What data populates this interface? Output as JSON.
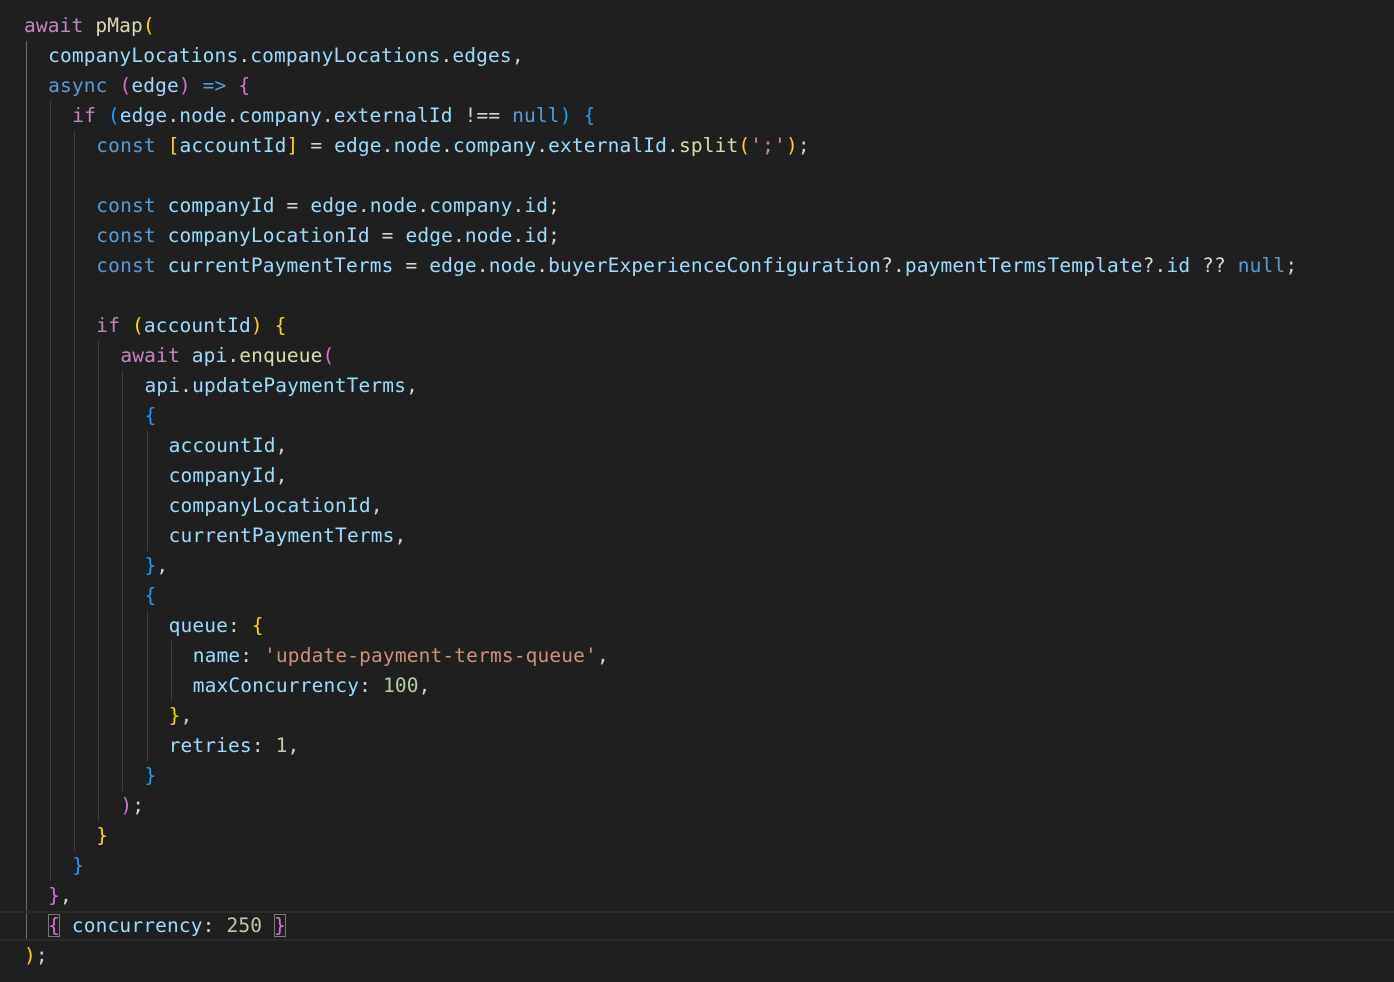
{
  "colors": {
    "background": "#1f1f1f",
    "keyword_control": "#c586c0",
    "keyword_storage": "#569cd6",
    "variable": "#9cdcfe",
    "function": "#dcdcaa",
    "string": "#ce9178",
    "number": "#b5cea8",
    "plain": "#d4d4d4",
    "bracket_1": "#ffd700",
    "bracket_2": "#da70d6",
    "bracket_3": "#179fff"
  },
  "code_lines": [
    {
      "indent": 0,
      "tokens": [
        {
          "t": "await",
          "c": "keyword_control"
        },
        {
          "t": " "
        },
        {
          "t": "pMap",
          "c": "function"
        },
        {
          "t": "(",
          "c": "bracket_1"
        }
      ]
    },
    {
      "indent": 1,
      "tokens": [
        {
          "t": "companyLocations",
          "c": "variable"
        },
        {
          "t": "."
        },
        {
          "t": "companyLocations",
          "c": "variable"
        },
        {
          "t": "."
        },
        {
          "t": "edges",
          "c": "variable"
        },
        {
          "t": ","
        }
      ]
    },
    {
      "indent": 1,
      "tokens": [
        {
          "t": "async",
          "c": "keyword_storage"
        },
        {
          "t": " "
        },
        {
          "t": "(",
          "c": "bracket_2"
        },
        {
          "t": "edge",
          "c": "variable"
        },
        {
          "t": ")",
          "c": "bracket_2"
        },
        {
          "t": " "
        },
        {
          "t": "=>",
          "c": "keyword_storage"
        },
        {
          "t": " "
        },
        {
          "t": "{",
          "c": "bracket_2"
        }
      ]
    },
    {
      "indent": 2,
      "tokens": [
        {
          "t": "if",
          "c": "keyword_control"
        },
        {
          "t": " "
        },
        {
          "t": "(",
          "c": "bracket_3"
        },
        {
          "t": "edge",
          "c": "variable"
        },
        {
          "t": "."
        },
        {
          "t": "node",
          "c": "variable"
        },
        {
          "t": "."
        },
        {
          "t": "company",
          "c": "variable"
        },
        {
          "t": "."
        },
        {
          "t": "externalId",
          "c": "variable"
        },
        {
          "t": " !== "
        },
        {
          "t": "null",
          "c": "keyword_storage"
        },
        {
          "t": ")",
          "c": "bracket_3"
        },
        {
          "t": " "
        },
        {
          "t": "{",
          "c": "bracket_3"
        }
      ]
    },
    {
      "indent": 3,
      "tokens": [
        {
          "t": "const",
          "c": "keyword_storage"
        },
        {
          "t": " "
        },
        {
          "t": "[",
          "c": "bracket_1"
        },
        {
          "t": "accountId",
          "c": "variable"
        },
        {
          "t": "]",
          "c": "bracket_1"
        },
        {
          "t": " = "
        },
        {
          "t": "edge",
          "c": "variable"
        },
        {
          "t": "."
        },
        {
          "t": "node",
          "c": "variable"
        },
        {
          "t": "."
        },
        {
          "t": "company",
          "c": "variable"
        },
        {
          "t": "."
        },
        {
          "t": "externalId",
          "c": "variable"
        },
        {
          "t": "."
        },
        {
          "t": "split",
          "c": "function"
        },
        {
          "t": "(",
          "c": "bracket_1"
        },
        {
          "t": "';'",
          "c": "string"
        },
        {
          "t": ")",
          "c": "bracket_1"
        },
        {
          "t": ";"
        }
      ]
    },
    {
      "indent": 3,
      "tokens": []
    },
    {
      "indent": 3,
      "tokens": [
        {
          "t": "const",
          "c": "keyword_storage"
        },
        {
          "t": " "
        },
        {
          "t": "companyId",
          "c": "variable"
        },
        {
          "t": " = "
        },
        {
          "t": "edge",
          "c": "variable"
        },
        {
          "t": "."
        },
        {
          "t": "node",
          "c": "variable"
        },
        {
          "t": "."
        },
        {
          "t": "company",
          "c": "variable"
        },
        {
          "t": "."
        },
        {
          "t": "id",
          "c": "variable"
        },
        {
          "t": ";"
        }
      ]
    },
    {
      "indent": 3,
      "tokens": [
        {
          "t": "const",
          "c": "keyword_storage"
        },
        {
          "t": " "
        },
        {
          "t": "companyLocationId",
          "c": "variable"
        },
        {
          "t": " = "
        },
        {
          "t": "edge",
          "c": "variable"
        },
        {
          "t": "."
        },
        {
          "t": "node",
          "c": "variable"
        },
        {
          "t": "."
        },
        {
          "t": "id",
          "c": "variable"
        },
        {
          "t": ";"
        }
      ]
    },
    {
      "indent": 3,
      "tokens": [
        {
          "t": "const",
          "c": "keyword_storage"
        },
        {
          "t": " "
        },
        {
          "t": "currentPaymentTerms",
          "c": "variable"
        },
        {
          "t": " = "
        },
        {
          "t": "edge",
          "c": "variable"
        },
        {
          "t": "."
        },
        {
          "t": "node",
          "c": "variable"
        },
        {
          "t": "."
        },
        {
          "t": "buyerExperienceConfiguration",
          "c": "variable"
        },
        {
          "t": "?."
        },
        {
          "t": "paymentTermsTemplate",
          "c": "variable"
        },
        {
          "t": "?."
        },
        {
          "t": "id",
          "c": "variable"
        },
        {
          "t": " ?? "
        },
        {
          "t": "null",
          "c": "keyword_storage"
        },
        {
          "t": ";"
        }
      ]
    },
    {
      "indent": 3,
      "tokens": []
    },
    {
      "indent": 3,
      "tokens": [
        {
          "t": "if",
          "c": "keyword_control"
        },
        {
          "t": " "
        },
        {
          "t": "(",
          "c": "bracket_1"
        },
        {
          "t": "accountId",
          "c": "variable"
        },
        {
          "t": ")",
          "c": "bracket_1"
        },
        {
          "t": " "
        },
        {
          "t": "{",
          "c": "bracket_1"
        }
      ]
    },
    {
      "indent": 4,
      "tokens": [
        {
          "t": "await",
          "c": "keyword_control"
        },
        {
          "t": " "
        },
        {
          "t": "api",
          "c": "variable"
        },
        {
          "t": "."
        },
        {
          "t": "enqueue",
          "c": "function"
        },
        {
          "t": "(",
          "c": "bracket_2"
        }
      ]
    },
    {
      "indent": 5,
      "tokens": [
        {
          "t": "api",
          "c": "variable"
        },
        {
          "t": "."
        },
        {
          "t": "updatePaymentTerms",
          "c": "variable"
        },
        {
          "t": ","
        }
      ]
    },
    {
      "indent": 5,
      "tokens": [
        {
          "t": "{",
          "c": "bracket_3"
        }
      ]
    },
    {
      "indent": 6,
      "tokens": [
        {
          "t": "accountId",
          "c": "variable"
        },
        {
          "t": ","
        }
      ]
    },
    {
      "indent": 6,
      "tokens": [
        {
          "t": "companyId",
          "c": "variable"
        },
        {
          "t": ","
        }
      ]
    },
    {
      "indent": 6,
      "tokens": [
        {
          "t": "companyLocationId",
          "c": "variable"
        },
        {
          "t": ","
        }
      ]
    },
    {
      "indent": 6,
      "tokens": [
        {
          "t": "currentPaymentTerms",
          "c": "variable"
        },
        {
          "t": ","
        }
      ]
    },
    {
      "indent": 5,
      "tokens": [
        {
          "t": "}",
          "c": "bracket_3"
        },
        {
          "t": ","
        }
      ]
    },
    {
      "indent": 5,
      "tokens": [
        {
          "t": "{",
          "c": "bracket_3"
        }
      ]
    },
    {
      "indent": 6,
      "tokens": [
        {
          "t": "queue",
          "c": "variable"
        },
        {
          "t": ": "
        },
        {
          "t": "{",
          "c": "bracket_1"
        }
      ]
    },
    {
      "indent": 7,
      "tokens": [
        {
          "t": "name",
          "c": "variable"
        },
        {
          "t": ": "
        },
        {
          "t": "'update-payment-terms-queue'",
          "c": "string"
        },
        {
          "t": ","
        }
      ]
    },
    {
      "indent": 7,
      "tokens": [
        {
          "t": "maxConcurrency",
          "c": "variable"
        },
        {
          "t": ": "
        },
        {
          "t": "100",
          "c": "number"
        },
        {
          "t": ","
        }
      ]
    },
    {
      "indent": 6,
      "tokens": [
        {
          "t": "}",
          "c": "bracket_1"
        },
        {
          "t": ","
        }
      ]
    },
    {
      "indent": 6,
      "tokens": [
        {
          "t": "retries",
          "c": "variable"
        },
        {
          "t": ": "
        },
        {
          "t": "1",
          "c": "number"
        },
        {
          "t": ","
        }
      ]
    },
    {
      "indent": 5,
      "tokens": [
        {
          "t": "}",
          "c": "bracket_3"
        }
      ]
    },
    {
      "indent": 4,
      "tokens": [
        {
          "t": ")",
          "c": "bracket_2"
        },
        {
          "t": ";"
        }
      ]
    },
    {
      "indent": 3,
      "tokens": [
        {
          "t": "}",
          "c": "bracket_1"
        }
      ]
    },
    {
      "indent": 2,
      "tokens": [
        {
          "t": "}",
          "c": "bracket_3"
        }
      ]
    },
    {
      "indent": 1,
      "tokens": [
        {
          "t": "}",
          "c": "bracket_2"
        },
        {
          "t": ","
        }
      ]
    },
    {
      "indent": 1,
      "current": true,
      "tokens": [
        {
          "t": "{",
          "c": "bracket_2",
          "match": true
        },
        {
          "t": " "
        },
        {
          "t": "concurrency",
          "c": "variable"
        },
        {
          "t": ": "
        },
        {
          "t": "250",
          "c": "number"
        },
        {
          "t": " "
        },
        {
          "t": "}",
          "c": "bracket_2",
          "match": true
        }
      ]
    },
    {
      "indent": 0,
      "tokens": [
        {
          "t": ")",
          "c": "bracket_1"
        },
        {
          "t": ";"
        }
      ]
    }
  ]
}
